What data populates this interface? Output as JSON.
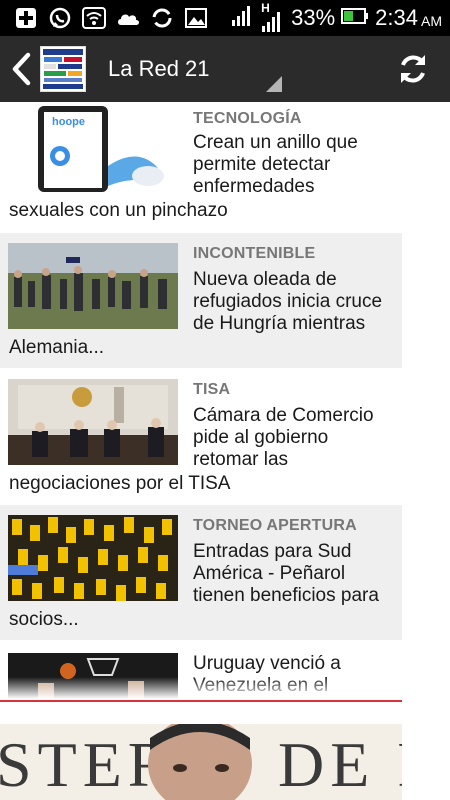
{
  "status_bar": {
    "battery_percent_text": "33%",
    "time": "2:34",
    "ampm": "AM",
    "network_label": "H",
    "icons": [
      "notification-plus-icon",
      "whatsapp-icon",
      "wifi-icon",
      "cloud-icon",
      "sync-icon",
      "image-icon",
      "signal-icon",
      "data-signal-icon",
      "battery-icon"
    ]
  },
  "action_bar": {
    "title": "La Red 21",
    "logo_text": [
      "PERIÓDICOS",
      "URUGUAY"
    ],
    "colors": {
      "background": "#2b2b2b",
      "accent_divider": "#d8323b"
    }
  },
  "feed": {
    "items": [
      {
        "category": "TECNOLOGÍA",
        "headline": "Crean un anillo que permite detectar enfermedades",
        "headline_tail": "sexuales con un pinchazo",
        "thumb_label": "hoope"
      },
      {
        "category": "INCONTENIBLE",
        "headline": "Nueva oleada de refugiados inicia cruce de Hungría mientras",
        "headline_tail": "Alemania...",
        "thumb_label": ""
      },
      {
        "category": "TISA",
        "headline": "Cámara de Comercio pide al gobierno retomar las",
        "headline_tail": "negociaciones por el TISA",
        "thumb_label": ""
      },
      {
        "category": "TORNEO APERTURA",
        "headline": "Entradas para Sud América - Peñarol tienen beneficios para",
        "headline_tail": "socios...",
        "thumb_label": ""
      },
      {
        "category": "",
        "headline": "Uruguay venció a Venezuela en el",
        "headline_tail": "",
        "thumb_label": ""
      }
    ],
    "banner_text": "STERIO DE R"
  }
}
